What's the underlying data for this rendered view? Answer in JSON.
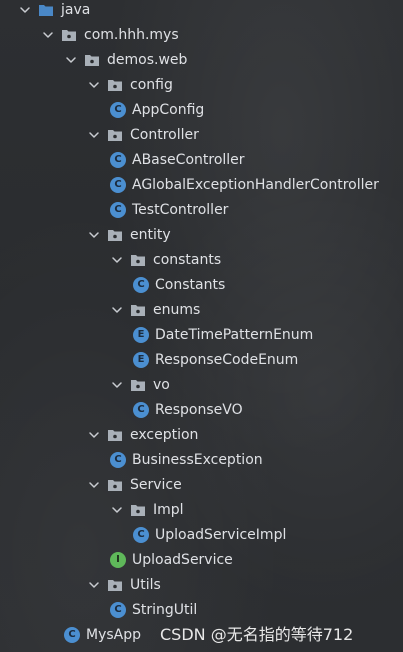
{
  "tree": [
    {
      "label": "java",
      "depth": 0,
      "type": "src-folder",
      "expanded": true
    },
    {
      "label": "com.hhh.mys",
      "depth": 1,
      "type": "package",
      "expanded": true
    },
    {
      "label": "demos.web",
      "depth": 2,
      "type": "package",
      "expanded": true
    },
    {
      "label": "config",
      "depth": 3,
      "type": "package",
      "expanded": true
    },
    {
      "label": "AppConfig",
      "depth": 4,
      "type": "class",
      "expanded": null
    },
    {
      "label": "Controller",
      "depth": 3,
      "type": "package",
      "expanded": true
    },
    {
      "label": "ABaseController",
      "depth": 4,
      "type": "class",
      "expanded": null
    },
    {
      "label": "AGlobalExceptionHandlerController",
      "depth": 4,
      "type": "class",
      "expanded": null
    },
    {
      "label": "TestController",
      "depth": 4,
      "type": "class",
      "expanded": null
    },
    {
      "label": "entity",
      "depth": 3,
      "type": "package",
      "expanded": true
    },
    {
      "label": "constants",
      "depth": 4,
      "type": "package",
      "expanded": true
    },
    {
      "label": "Constants",
      "depth": 5,
      "type": "class",
      "expanded": null
    },
    {
      "label": "enums",
      "depth": 4,
      "type": "package",
      "expanded": true
    },
    {
      "label": "DateTimePatternEnum",
      "depth": 5,
      "type": "enum",
      "expanded": null
    },
    {
      "label": "ResponseCodeEnum",
      "depth": 5,
      "type": "enum",
      "expanded": null
    },
    {
      "label": "vo",
      "depth": 4,
      "type": "package",
      "expanded": true
    },
    {
      "label": "ResponseVO",
      "depth": 5,
      "type": "class",
      "expanded": null
    },
    {
      "label": "exception",
      "depth": 3,
      "type": "package",
      "expanded": true
    },
    {
      "label": "BusinessException",
      "depth": 4,
      "type": "class",
      "expanded": null
    },
    {
      "label": "Service",
      "depth": 3,
      "type": "package",
      "expanded": true
    },
    {
      "label": "Impl",
      "depth": 4,
      "type": "package",
      "expanded": true
    },
    {
      "label": "UploadServiceImpl",
      "depth": 5,
      "type": "class",
      "expanded": null
    },
    {
      "label": "UploadService",
      "depth": 4,
      "type": "interface",
      "expanded": null
    },
    {
      "label": "Utils",
      "depth": 3,
      "type": "package",
      "expanded": true
    },
    {
      "label": "StringUtil",
      "depth": 4,
      "type": "class",
      "expanded": null
    },
    {
      "label": "MysApp",
      "depth": 2,
      "type": "app-class",
      "expanded": null
    }
  ],
  "icon_letters": {
    "class": "C",
    "enum": "E",
    "interface": "I",
    "app-class": "C"
  },
  "watermark": "CSDN @无名指的等待712",
  "colors": {
    "background": "#2b2d30",
    "text": "#dfe1e5",
    "class_icon": "#4b8fd1",
    "interface_icon": "#5fb85a",
    "folder_icon": "#a9b0b8",
    "src_folder_icon": "#4a88c7"
  }
}
